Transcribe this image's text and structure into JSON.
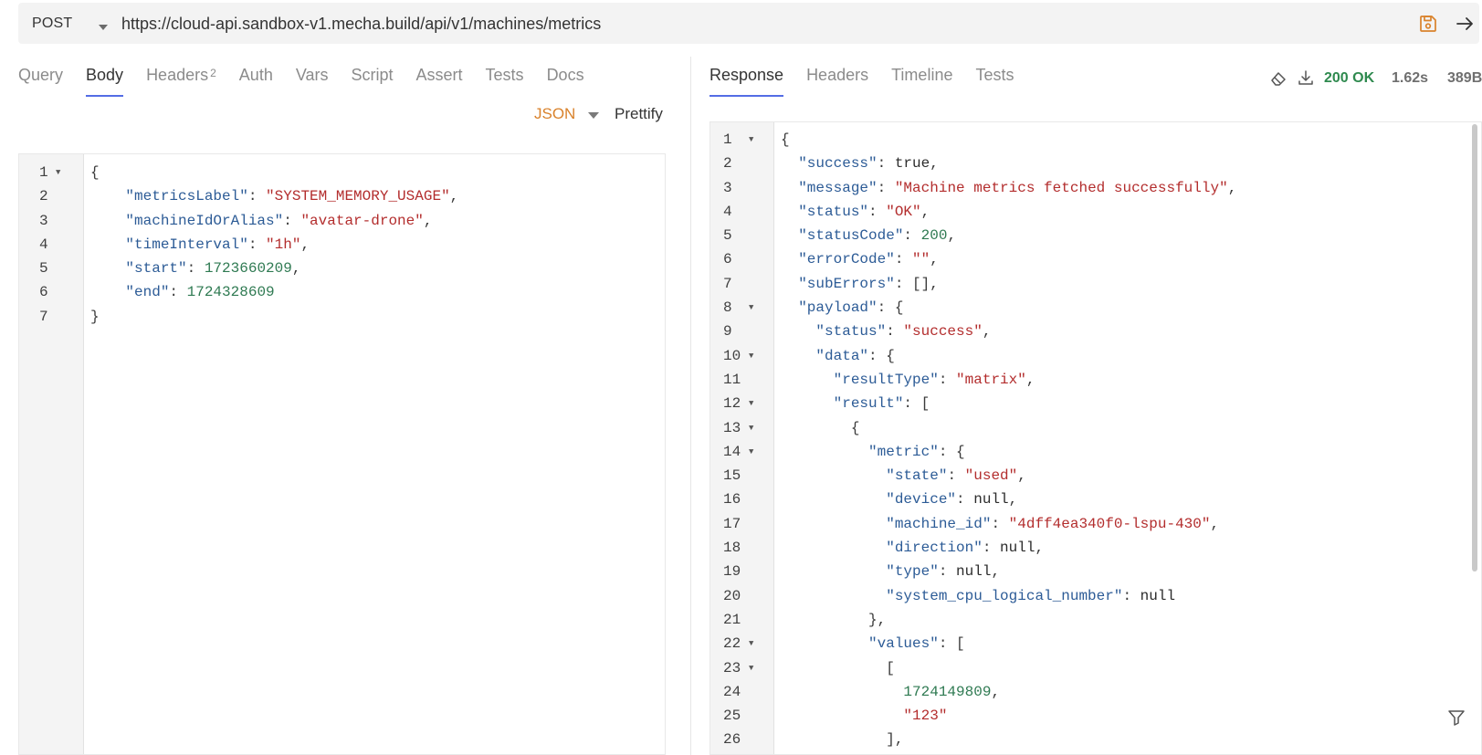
{
  "request": {
    "method": "POST",
    "url": "https://cloud-api.sandbox-v1.mecha.build/api/v1/machines/metrics",
    "tabs": [
      {
        "label": "Query",
        "sup": ""
      },
      {
        "label": "Body",
        "sup": "",
        "active": true
      },
      {
        "label": "Headers",
        "sup": "2"
      },
      {
        "label": "Auth",
        "sup": ""
      },
      {
        "label": "Vars",
        "sup": ""
      },
      {
        "label": "Script",
        "sup": ""
      },
      {
        "label": "Assert",
        "sup": ""
      },
      {
        "label": "Tests",
        "sup": ""
      },
      {
        "label": "Docs",
        "sup": ""
      }
    ],
    "body_mode": "JSON",
    "prettify_label": "Prettify",
    "editor": {
      "line_numbers": [
        "1",
        "2",
        "3",
        "4",
        "5",
        "6",
        "7"
      ],
      "foldable_lines": [
        1
      ],
      "lines": [
        [
          {
            "t": "p",
            "v": "{"
          }
        ],
        [
          {
            "t": "p",
            "v": "    "
          },
          {
            "t": "k",
            "v": "\"metricsLabel\""
          },
          {
            "t": "p",
            "v": ": "
          },
          {
            "t": "s",
            "v": "\"SYSTEM_MEMORY_USAGE\""
          },
          {
            "t": "p",
            "v": ","
          }
        ],
        [
          {
            "t": "p",
            "v": "    "
          },
          {
            "t": "k",
            "v": "\"machineIdOrAlias\""
          },
          {
            "t": "p",
            "v": ": "
          },
          {
            "t": "s",
            "v": "\"avatar-drone\""
          },
          {
            "t": "p",
            "v": ","
          }
        ],
        [
          {
            "t": "p",
            "v": "    "
          },
          {
            "t": "k",
            "v": "\"timeInterval\""
          },
          {
            "t": "p",
            "v": ": "
          },
          {
            "t": "s",
            "v": "\"1h\""
          },
          {
            "t": "p",
            "v": ","
          }
        ],
        [
          {
            "t": "p",
            "v": "    "
          },
          {
            "t": "k",
            "v": "\"start\""
          },
          {
            "t": "p",
            "v": ": "
          },
          {
            "t": "n",
            "v": "1723660209"
          },
          {
            "t": "p",
            "v": ","
          }
        ],
        [
          {
            "t": "p",
            "v": "    "
          },
          {
            "t": "k",
            "v": "\"end\""
          },
          {
            "t": "p",
            "v": ": "
          },
          {
            "t": "n",
            "v": "1724328609"
          }
        ],
        [
          {
            "t": "p",
            "v": "}"
          }
        ]
      ]
    }
  },
  "response": {
    "tabs": [
      {
        "label": "Response",
        "active": true
      },
      {
        "label": "Headers"
      },
      {
        "label": "Timeline"
      },
      {
        "label": "Tests"
      }
    ],
    "status": "200 OK",
    "time": "1.62s",
    "size": "389B",
    "editor": {
      "line_numbers": [
        "1",
        "2",
        "3",
        "4",
        "5",
        "6",
        "7",
        "8",
        "9",
        "10",
        "11",
        "12",
        "13",
        "14",
        "15",
        "16",
        "17",
        "18",
        "19",
        "20",
        "21",
        "22",
        "23",
        "24",
        "25",
        "26"
      ],
      "foldable_lines": [
        1,
        8,
        10,
        12,
        13,
        14,
        22,
        23
      ],
      "lines": [
        [
          {
            "t": "p",
            "v": "{"
          }
        ],
        [
          {
            "t": "p",
            "v": "  "
          },
          {
            "t": "k",
            "v": "\"success\""
          },
          {
            "t": "p",
            "v": ": "
          },
          {
            "t": "b",
            "v": "true"
          },
          {
            "t": "p",
            "v": ","
          }
        ],
        [
          {
            "t": "p",
            "v": "  "
          },
          {
            "t": "k",
            "v": "\"message\""
          },
          {
            "t": "p",
            "v": ": "
          },
          {
            "t": "s",
            "v": "\"Machine metrics fetched successfully\""
          },
          {
            "t": "p",
            "v": ","
          }
        ],
        [
          {
            "t": "p",
            "v": "  "
          },
          {
            "t": "k",
            "v": "\"status\""
          },
          {
            "t": "p",
            "v": ": "
          },
          {
            "t": "s",
            "v": "\"OK\""
          },
          {
            "t": "p",
            "v": ","
          }
        ],
        [
          {
            "t": "p",
            "v": "  "
          },
          {
            "t": "k",
            "v": "\"statusCode\""
          },
          {
            "t": "p",
            "v": ": "
          },
          {
            "t": "n",
            "v": "200"
          },
          {
            "t": "p",
            "v": ","
          }
        ],
        [
          {
            "t": "p",
            "v": "  "
          },
          {
            "t": "k",
            "v": "\"errorCode\""
          },
          {
            "t": "p",
            "v": ": "
          },
          {
            "t": "s",
            "v": "\"\""
          },
          {
            "t": "p",
            "v": ","
          }
        ],
        [
          {
            "t": "p",
            "v": "  "
          },
          {
            "t": "k",
            "v": "\"subErrors\""
          },
          {
            "t": "p",
            "v": ": [],"
          }
        ],
        [
          {
            "t": "p",
            "v": "  "
          },
          {
            "t": "k",
            "v": "\"payload\""
          },
          {
            "t": "p",
            "v": ": {"
          }
        ],
        [
          {
            "t": "p",
            "v": "    "
          },
          {
            "t": "k",
            "v": "\"status\""
          },
          {
            "t": "p",
            "v": ": "
          },
          {
            "t": "s",
            "v": "\"success\""
          },
          {
            "t": "p",
            "v": ","
          }
        ],
        [
          {
            "t": "p",
            "v": "    "
          },
          {
            "t": "k",
            "v": "\"data\""
          },
          {
            "t": "p",
            "v": ": {"
          }
        ],
        [
          {
            "t": "p",
            "v": "      "
          },
          {
            "t": "k",
            "v": "\"resultType\""
          },
          {
            "t": "p",
            "v": ": "
          },
          {
            "t": "s",
            "v": "\"matrix\""
          },
          {
            "t": "p",
            "v": ","
          }
        ],
        [
          {
            "t": "p",
            "v": "      "
          },
          {
            "t": "k",
            "v": "\"result\""
          },
          {
            "t": "p",
            "v": ": ["
          }
        ],
        [
          {
            "t": "p",
            "v": "        {"
          }
        ],
        [
          {
            "t": "p",
            "v": "          "
          },
          {
            "t": "k",
            "v": "\"metric\""
          },
          {
            "t": "p",
            "v": ": {"
          }
        ],
        [
          {
            "t": "p",
            "v": "            "
          },
          {
            "t": "k",
            "v": "\"state\""
          },
          {
            "t": "p",
            "v": ": "
          },
          {
            "t": "s",
            "v": "\"used\""
          },
          {
            "t": "p",
            "v": ","
          }
        ],
        [
          {
            "t": "p",
            "v": "            "
          },
          {
            "t": "k",
            "v": "\"device\""
          },
          {
            "t": "p",
            "v": ": "
          },
          {
            "t": "b",
            "v": "null"
          },
          {
            "t": "p",
            "v": ","
          }
        ],
        [
          {
            "t": "p",
            "v": "            "
          },
          {
            "t": "k",
            "v": "\"machine_id\""
          },
          {
            "t": "p",
            "v": ": "
          },
          {
            "t": "s",
            "v": "\"4dff4ea340f0-lspu-430\""
          },
          {
            "t": "p",
            "v": ","
          }
        ],
        [
          {
            "t": "p",
            "v": "            "
          },
          {
            "t": "k",
            "v": "\"direction\""
          },
          {
            "t": "p",
            "v": ": "
          },
          {
            "t": "b",
            "v": "null"
          },
          {
            "t": "p",
            "v": ","
          }
        ],
        [
          {
            "t": "p",
            "v": "            "
          },
          {
            "t": "k",
            "v": "\"type\""
          },
          {
            "t": "p",
            "v": ": "
          },
          {
            "t": "b",
            "v": "null"
          },
          {
            "t": "p",
            "v": ","
          }
        ],
        [
          {
            "t": "p",
            "v": "            "
          },
          {
            "t": "k",
            "v": "\"system_cpu_logical_number\""
          },
          {
            "t": "p",
            "v": ": "
          },
          {
            "t": "b",
            "v": "null"
          }
        ],
        [
          {
            "t": "p",
            "v": "          },"
          }
        ],
        [
          {
            "t": "p",
            "v": "          "
          },
          {
            "t": "k",
            "v": "\"values\""
          },
          {
            "t": "p",
            "v": ": ["
          }
        ],
        [
          {
            "t": "p",
            "v": "            ["
          }
        ],
        [
          {
            "t": "p",
            "v": "              "
          },
          {
            "t": "n",
            "v": "1724149809"
          },
          {
            "t": "p",
            "v": ","
          }
        ],
        [
          {
            "t": "p",
            "v": "              "
          },
          {
            "t": "s",
            "v": "\"123\""
          }
        ],
        [
          {
            "t": "p",
            "v": "            ],"
          }
        ]
      ]
    }
  },
  "colors": {
    "accent": "#546de5",
    "status_ok": "#2f8a4f",
    "json_mode": "#d9822b",
    "save_icon": "#d9822b"
  },
  "icons": [
    "chevron-down-icon",
    "save-icon",
    "arrow-right-icon",
    "eraser-icon",
    "download-icon",
    "filter-icon"
  ]
}
